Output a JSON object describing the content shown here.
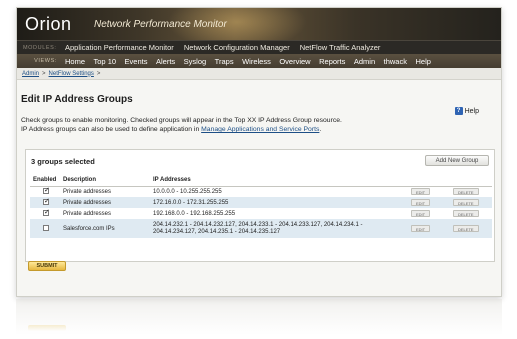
{
  "header": {
    "brand": "Orion",
    "product": "Network Performance Monitor"
  },
  "modules": {
    "label": "MODULES:",
    "items": [
      "Application Performance Monitor",
      "Network Configuration Manager",
      "NetFlow Traffic Analyzer"
    ]
  },
  "views": {
    "label": "VIEWS:",
    "items": [
      "Home",
      "Top 10",
      "Events",
      "Alerts",
      "Syslog",
      "Traps",
      "Wireless",
      "Overview",
      "Reports",
      "Admin",
      "thwack",
      "Help"
    ]
  },
  "breadcrumb": {
    "items": [
      "Admin",
      "NetFlow Settings"
    ],
    "separator": ">"
  },
  "page": {
    "title": "Edit IP Address Groups",
    "help_label": "Help",
    "description_line1": "Check groups to enable monitoring. Checked groups will appear in the Top XX IP Address Group resource.",
    "description_line2_prefix": "IP Address groups can also be used to define application in ",
    "description_link": "Manage Applications and Service Ports",
    "description_suffix": "."
  },
  "groups": {
    "selected_label": "3 groups selected",
    "add_button": "Add New Group",
    "columns": [
      "Enabled",
      "Description",
      "IP Addresses",
      "",
      ""
    ],
    "edit_label": "EDIT",
    "delete_label": "DELETE",
    "rows": [
      {
        "enabled": true,
        "description": "Private addresses",
        "ips": "10.0.0.0 - 10.255.255.255"
      },
      {
        "enabled": true,
        "description": "Private addresses",
        "ips": "172.16.0.0 - 172.31.255.255"
      },
      {
        "enabled": true,
        "description": "Private addresses",
        "ips": "192.168.0.0 - 192.168.255.255"
      },
      {
        "enabled": false,
        "description": "Salesforce.com IPs",
        "ips_line1": "204.14.232.1 - 204.14.232.127, 204.14.233.1 - 204.14.233.127, 204.14.234.1 -",
        "ips_line2": "204.14.234.127, 204.14.235.1 - 204.14.235.127"
      }
    ]
  },
  "submit_label": "SUBMIT",
  "colors": {
    "accent_gold": "#e6b840",
    "link_blue": "#1d4f86",
    "row_alt": "#dfeaf2"
  }
}
